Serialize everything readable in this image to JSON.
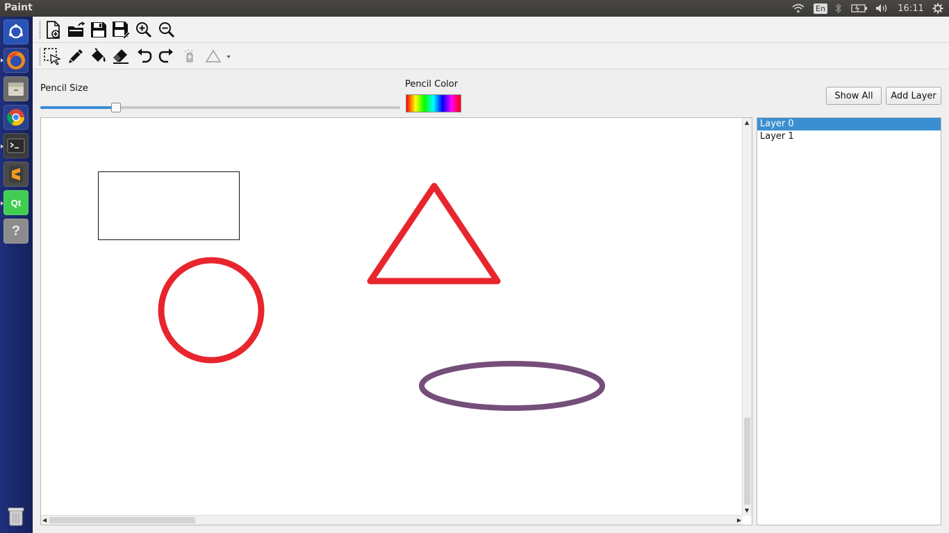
{
  "window": {
    "title": "Paint"
  },
  "top_panel": {
    "clock": "16:11",
    "keyboard_layout": "En"
  },
  "launcher": {
    "items": [
      "ubuntu-dash",
      "firefox",
      "files",
      "chrome",
      "terminal",
      "sublime-text",
      "qt-creator",
      "help"
    ]
  },
  "toolbar1": {
    "tools": [
      "new-file",
      "open-file",
      "save",
      "save-as",
      "zoom-in",
      "zoom-out"
    ]
  },
  "toolbar2": {
    "tools": [
      "select",
      "pencil",
      "fill",
      "eraser",
      "undo",
      "redo",
      "spray",
      "shape-triangle"
    ]
  },
  "controls": {
    "pencil_size_label": "Pencil Size",
    "pencil_size_value": 0.21,
    "pencil_color_label": "Pencil Color",
    "show_all_label": "Show All",
    "add_layer_label": "Add Layer"
  },
  "layers": {
    "items": [
      {
        "label": "Layer 0",
        "selected": true
      },
      {
        "label": "Layer 1",
        "selected": false
      }
    ]
  },
  "colors": {
    "accent": "#3b8fd1",
    "red_shape": "#e8252d",
    "purple_shape": "#754e7a"
  }
}
